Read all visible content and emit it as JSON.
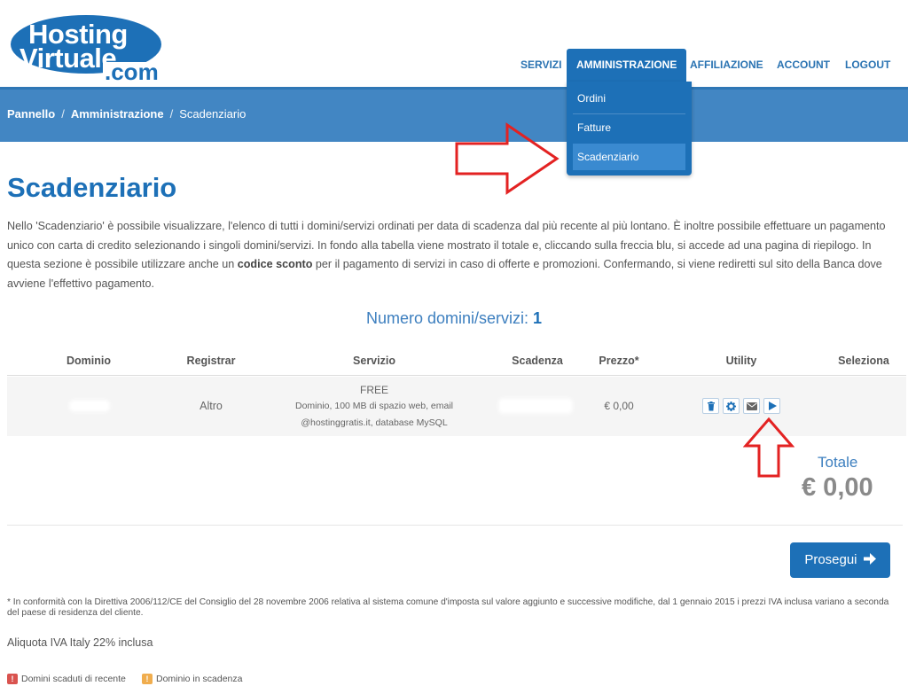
{
  "logo": {
    "line1": "Hosting",
    "line2": "Virtuale",
    "line3": ".com"
  },
  "nav": {
    "items": [
      "SERVIZI",
      "AMMINISTRAZIONE",
      "AFFILIAZIONE",
      "ACCOUNT",
      "LOGOUT"
    ],
    "active": "AMMINISTRAZIONE",
    "dropdown": [
      "Ordini",
      "Fatture",
      "Scadenziario"
    ],
    "dropdown_selected": "Scadenziario"
  },
  "breadcrumb": {
    "items": [
      "Pannello",
      "Amministrazione",
      "Scadenziario"
    ],
    "separator": "/"
  },
  "page": {
    "title": "Scadenziario",
    "intro_1": "Nello 'Scadenziario' è possibile visualizzare, l'elenco di tutti i domini/servizi ordinati per data di scadenza dal più recente al più lontano. È inoltre possibile effettuare un pagamento unico con carta di credito selezionando i singoli domini/servizi. In fondo alla tabella viene mostrato il totale e, cliccando sulla freccia blu, si accede ad una pagina di riepilogo. In questa sezione è possibile utilizzare anche un ",
    "intro_bold": "codice sconto",
    "intro_2": " per il pagamento di servizi in caso di offerte e promozioni. Confermando, si viene rediretti sul sito della Banca dove avviene l'effettivo pagamento.",
    "count_label": "Numero domini/servizi: ",
    "count_value": "1"
  },
  "table": {
    "headers": [
      "Dominio",
      "Registrar",
      "Servizio",
      "Scadenza",
      "Prezzo*",
      "Utility",
      "Seleziona"
    ],
    "rows": [
      {
        "registrar": "Altro",
        "service_name": "FREE",
        "service_desc_1": "Dominio, 100 MB di spazio web, email",
        "service_desc_2": "@hostinggratis.it, database MySQL",
        "price": "€ 0,00",
        "utility_icons": [
          "trash-icon",
          "gear-icon",
          "envelope-icon",
          "play-icon"
        ]
      }
    ]
  },
  "total": {
    "label": "Totale",
    "value": "€ 0,00"
  },
  "proceed_button": "Prosegui",
  "footnote": "* In conformità con la Direttiva 2006/112/CE del Consiglio del 28 novembre 2006 relativa al sistema comune d'imposta sul valore aggiunto e successive modifiche, dal 1 gennaio 2015 i prezzi IVA inclusa variano a seconda del paese di residenza del cliente.",
  "aliquota": "Aliquota IVA Italy 22% inclusa",
  "legend": [
    {
      "label": "Domini scaduti di recente",
      "color": "#d9534f",
      "glyph": "!"
    },
    {
      "label": "Dominio in scadenza",
      "color": "#f0ad4e",
      "glyph": "!"
    }
  ],
  "colors": {
    "brand": "#1d70b7",
    "band": "#4286c3",
    "annotation_arrow": "#e32222"
  }
}
